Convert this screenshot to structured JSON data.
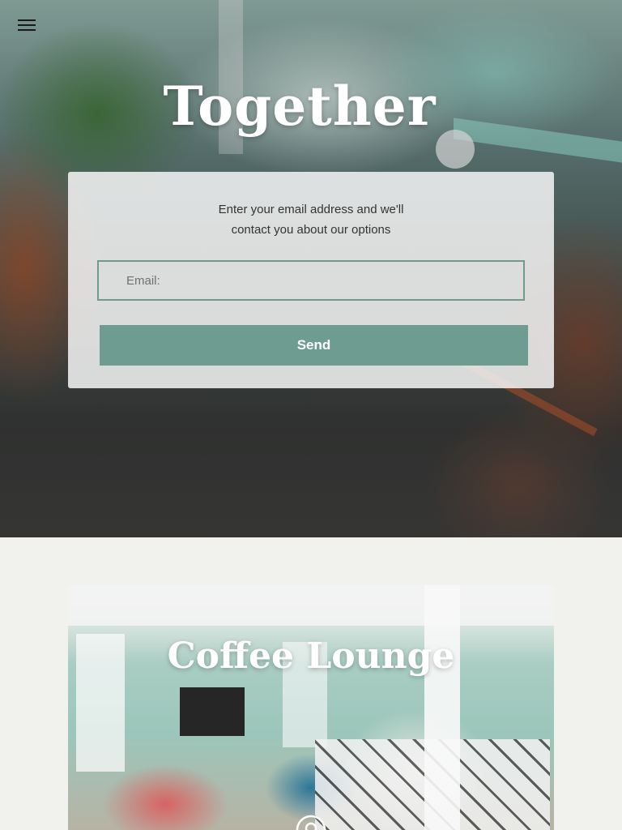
{
  "hero": {
    "title": "Together",
    "intro_text": "Enter your email address and we'll contact you about our options",
    "email_placeholder": "Email:",
    "send_label": "Send"
  },
  "menu": {
    "icon": "hamburger-menu-icon"
  },
  "lounge": {
    "title": "Coffee Lounge",
    "icon": "location-pin-icon"
  },
  "colors": {
    "accent": "#6f9c90",
    "page_background": "#f1f1ee",
    "title_text": "#ffffff"
  }
}
